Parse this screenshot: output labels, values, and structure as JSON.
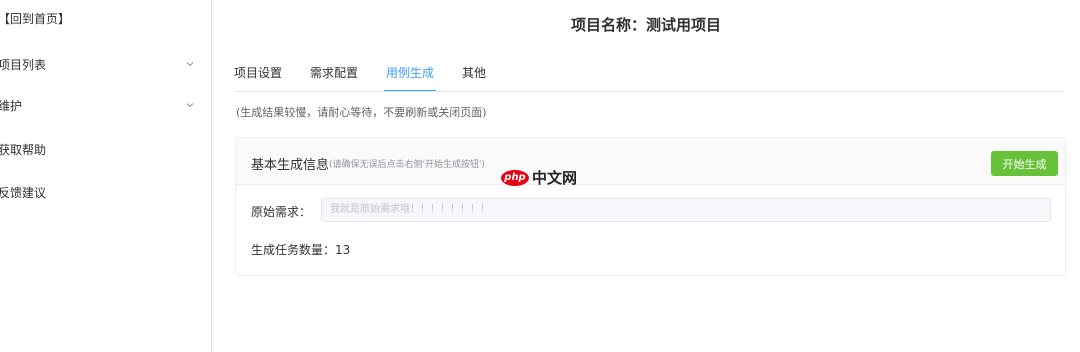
{
  "sidebar": {
    "items": [
      {
        "label": "【回到首页】",
        "has_chevron": false
      },
      {
        "label": "项目列表",
        "has_chevron": true
      },
      {
        "label": "维护",
        "has_chevron": true
      },
      {
        "label": "获取帮助",
        "has_chevron": false
      },
      {
        "label": "反馈建议",
        "has_chevron": false
      }
    ],
    "chevron_icon": "chevron-down-icon"
  },
  "header": {
    "project_title": "项目名称：测试用项目"
  },
  "tabs": [
    {
      "label": "项目设置",
      "active": false
    },
    {
      "label": "需求配置",
      "active": false
    },
    {
      "label": "用例生成",
      "active": true
    },
    {
      "label": "其他",
      "active": false
    }
  ],
  "hint": "(生成结果较慢，请耐心等待，不要刷新或关闭页面)",
  "card": {
    "title": "基本生成信息",
    "note": "(请确保无误后点击右侧'开始生成按钮')",
    "start_button": "开始生成",
    "requirement_label": "原始需求：",
    "requirement_value": "我就是原始需求哦！！！！！！！！",
    "count_label": "生成任务数量：",
    "count_value": "13"
  },
  "watermark": {
    "badge": "php",
    "text": "中文网"
  },
  "colors": {
    "accent": "#409eff",
    "success": "#67c23a",
    "brand_red": "#e60012"
  }
}
